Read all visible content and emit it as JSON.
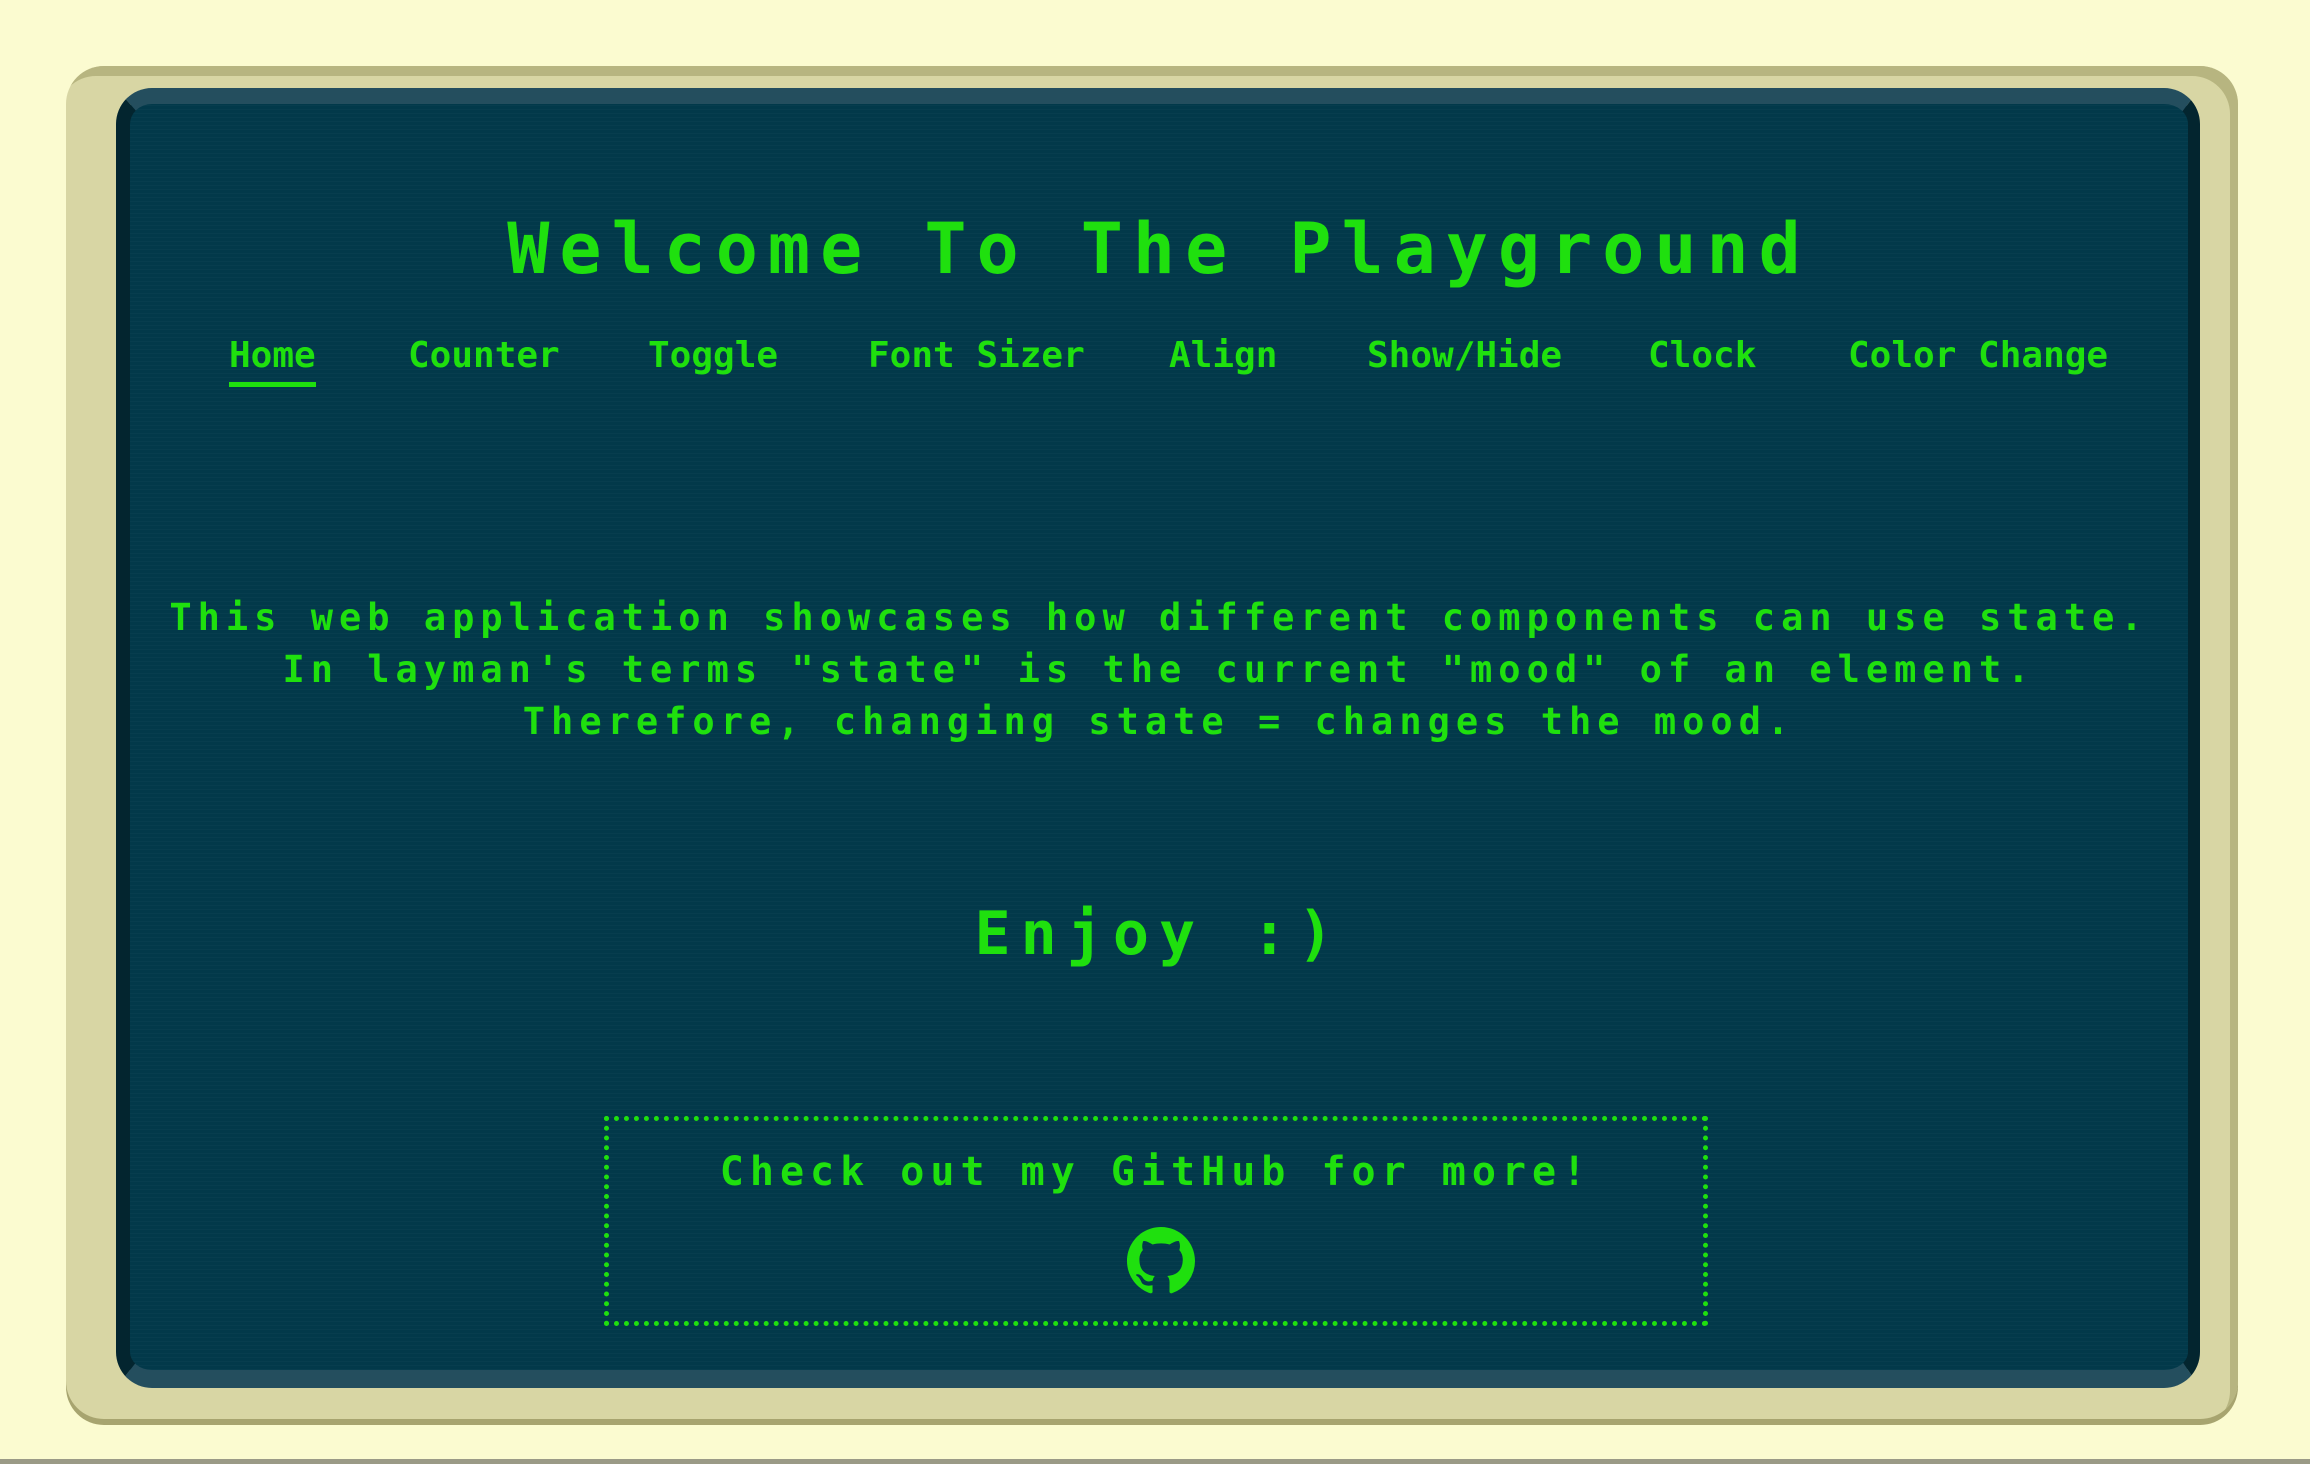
{
  "header": {
    "title": "Welcome To The Playground"
  },
  "nav": {
    "items": [
      {
        "label": "Home",
        "active": true
      },
      {
        "label": "Counter"
      },
      {
        "label": "Toggle"
      },
      {
        "label": "Font Sizer"
      },
      {
        "label": "Align"
      },
      {
        "label": "Show/Hide"
      },
      {
        "label": "Clock"
      },
      {
        "label": "Color Change"
      }
    ]
  },
  "main": {
    "description": [
      "This web application showcases how different components can use state.",
      "In layman's terms \"state\" is the current \"mood\" of an element.",
      "Therefore, changing state = changes the mood."
    ],
    "enjoy": "Enjoy :)"
  },
  "footer": {
    "github_text": "Check out my GitHub for more!",
    "github_icon": "github-icon"
  },
  "colors": {
    "text": "#1fe00e",
    "screen": "#02394a",
    "bezel": "#d8d6a4",
    "page": "#fbfbd0"
  }
}
